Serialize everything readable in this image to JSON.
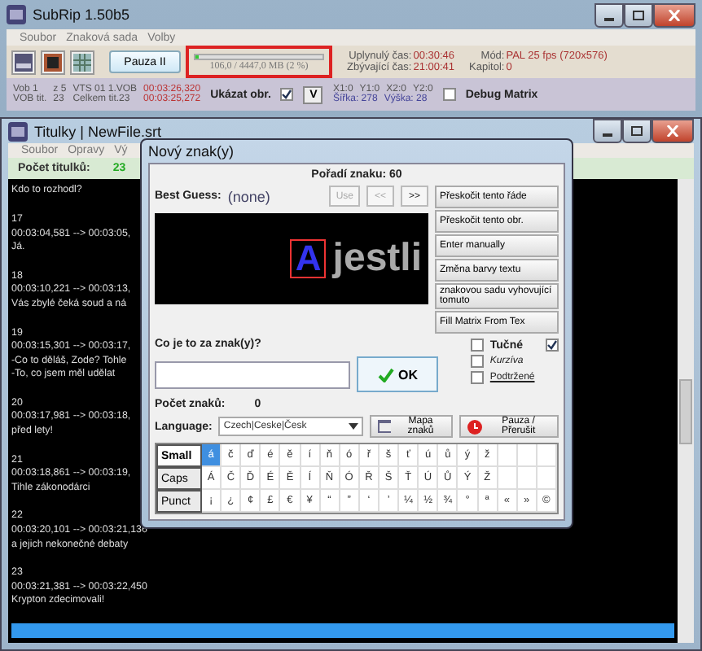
{
  "main_window": {
    "title": "SubRip 1.50b5",
    "menu": [
      "Soubor",
      "Znaková sada",
      "Volby"
    ],
    "pause_button": "Pauza II",
    "progress": {
      "level": 0.024,
      "reading": "106,0 / 4447,0 MB (2 %)"
    },
    "times": [
      {
        "label": "Uplynulý čas:",
        "value": "00:30:46"
      },
      {
        "label": "Zbývající čas:",
        "value": "21:00:41"
      }
    ],
    "mode": [
      {
        "label": "Mód:",
        "value": "PAL 25 fps (720x576)"
      },
      {
        "label": "Kapitol:",
        "value": "0"
      }
    ],
    "vob_info": [
      [
        "Vob 1",
        "z 5",
        "VTS 01 1.VOB",
        "00:03:26,320"
      ],
      [
        "VOB tit.",
        "23",
        "Celkem tit.23",
        "00:03:25,272"
      ]
    ],
    "show_image": {
      "label": "Ukázat obr.",
      "checked": true
    },
    "v_button": "V",
    "coords": [
      [
        "X1:0",
        "Y1:0",
        "X2:0",
        "Y2:0"
      ],
      [
        "Šířka: 278",
        "Výška: 28"
      ]
    ],
    "debug_matrix": {
      "label": "Debug Matrix",
      "checked": false
    }
  },
  "subtitles_window": {
    "title": "Titulky | NewFile.srt",
    "menu": [
      "Soubor",
      "Opravy",
      "Vý"
    ],
    "count_label": "Počet titulků:",
    "count": "23",
    "entries": [
      {
        "lines": [
          "Kdo to rozhodl?"
        ]
      },
      {
        "number": "17",
        "time": "00:03:04,581 --> 00:03:05,",
        "lines": [
          "Já."
        ]
      },
      {
        "number": "18",
        "time": "00:03:10,221 --> 00:03:13,",
        "lines": [
          "Vás zbylé čeká soud a ná"
        ]
      },
      {
        "number": "19",
        "time": "00:03:15,301 --> 00:03:17,",
        "lines": [
          "-Co to děláš, Zode? Tohle",
          "-To, co jsem měl udělat"
        ]
      },
      {
        "number": "20",
        "time": "00:03:17,981 --> 00:03:18,",
        "lines": [
          "před lety!"
        ]
      },
      {
        "number": "21",
        "time": "00:03:18,861 --> 00:03:19,",
        "lines": [
          "Tihle zákonodárci"
        ]
      },
      {
        "number": "22",
        "time": "00:03:20,101 --> 00:03:21,136",
        "lines": [
          "a jejich nekonečné debaty"
        ]
      },
      {
        "number": "23",
        "time": "00:03:21,381 --> 00:03:22,450",
        "lines": [
          "Krypton zdecimovali!"
        ]
      }
    ]
  },
  "dialog": {
    "title": "Nový znak(y)",
    "char_order": "Pořadí znaku: 60",
    "best_guess_label": "Best Guess:",
    "best_guess": "(none)",
    "nav_buttons": [
      {
        "label": "Use",
        "disabled": true
      },
      {
        "label": "<<",
        "disabled": true
      },
      {
        "label": ">>",
        "disabled": false
      }
    ],
    "preview": {
      "glyph": "A",
      "text": "jestli"
    },
    "side_buttons": [
      "Přeskočit tento řáde",
      "Přeskočit tento obr.",
      "Enter manually",
      "Změna barvy textu",
      "znakovou sadu vyhovující tomuto",
      "Fill Matrix From Tex"
    ],
    "question": "Co je to za znak(y)?",
    "ok_button": "OK",
    "count_label": "Počet znaků:",
    "count": "0",
    "styles": [
      {
        "label": "Tučné",
        "checked": false
      },
      {
        "label": "Kurzíva",
        "checked": false
      },
      {
        "label": "Podtržené",
        "checked": false
      }
    ],
    "extra_checked": true,
    "language_label": "Language:",
    "language": "Czech|Ceske|Česk",
    "charmap_button": "Mapa znaků",
    "pause_button": "Pauza / Přerušit",
    "char_tabs": [
      {
        "label": "Small",
        "selected": true
      },
      {
        "label": "Caps",
        "selected": false
      },
      {
        "label": "Punct",
        "selected": false
      }
    ],
    "char_rows": [
      [
        {
          "char": "á",
          "selected": true
        },
        {
          "char": "č",
          "selected": false
        },
        {
          "char": "ď",
          "selected": false
        },
        {
          "char": "é",
          "selected": false
        },
        {
          "char": "ě",
          "selected": false
        },
        {
          "char": "í",
          "selected": false
        },
        {
          "char": "ň",
          "selected": false
        },
        {
          "char": "ó",
          "selected": false
        },
        {
          "char": "ř",
          "selected": false
        },
        {
          "char": "š",
          "selected": false
        },
        {
          "char": "ť",
          "selected": false
        },
        {
          "char": "ú",
          "selected": false
        },
        {
          "char": "ů",
          "selected": false
        },
        {
          "char": "ý",
          "selected": false
        },
        {
          "char": "ž",
          "selected": false
        }
      ],
      [
        {
          "char": "Á",
          "selected": false
        },
        {
          "char": "Č",
          "selected": false
        },
        {
          "char": "Ď",
          "selected": false
        },
        {
          "char": "É",
          "selected": false
        },
        {
          "char": "Ě",
          "selected": false
        },
        {
          "char": "Í",
          "selected": false
        },
        {
          "char": "Ň",
          "selected": false
        },
        {
          "char": "Ó",
          "selected": false
        },
        {
          "char": "Ř",
          "selected": false
        },
        {
          "char": "Š",
          "selected": false
        },
        {
          "char": "Ť",
          "selected": false
        },
        {
          "char": "Ú",
          "selected": false
        },
        {
          "char": "Ů",
          "selected": false
        },
        {
          "char": "Ý",
          "selected": false
        },
        {
          "char": "Ž",
          "selected": false
        }
      ],
      [
        {
          "char": "¡",
          "selected": false
        },
        {
          "char": "¿",
          "selected": false
        },
        {
          "char": "¢",
          "selected": false
        },
        {
          "char": "£",
          "selected": false
        },
        {
          "char": "€",
          "selected": false
        },
        {
          "char": "¥",
          "selected": false
        },
        {
          "char": "“",
          "selected": false
        },
        {
          "char": "”",
          "selected": false
        },
        {
          "char": "‘",
          "selected": false
        },
        {
          "char": "’",
          "selected": false
        },
        {
          "char": "¼",
          "selected": false
        },
        {
          "char": "½",
          "selected": false
        },
        {
          "char": "¾",
          "selected": false
        },
        {
          "char": "°",
          "selected": false
        },
        {
          "char": "ª",
          "selected": false
        },
        {
          "char": "«",
          "selected": false
        },
        {
          "char": "»",
          "selected": false
        },
        {
          "char": "©",
          "selected": false
        }
      ]
    ]
  }
}
